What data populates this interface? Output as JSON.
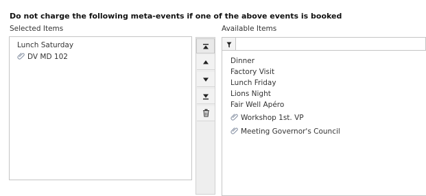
{
  "heading": "Do not charge the following meta-events if one of the above events is booked",
  "selected": {
    "label": "Selected Items",
    "items": [
      {
        "label": "Lunch Saturday",
        "icon": "none"
      },
      {
        "label": "DV MD 102",
        "icon": "paperclip-icon"
      }
    ]
  },
  "controls": {
    "move_top_icon": "move-to-top-icon",
    "move_up_icon": "arrow-up-icon",
    "move_down_icon": "arrow-down-icon",
    "move_bottom_icon": "move-to-bottom-icon",
    "remove_icon": "trash-icon"
  },
  "available": {
    "label": "Available Items",
    "filter_icon": "filter-icon",
    "filter_value": "",
    "items": [
      {
        "label": "Dinner",
        "icon": "none"
      },
      {
        "label": "Factory Visit",
        "icon": "none"
      },
      {
        "label": "Lunch Friday",
        "icon": "none"
      },
      {
        "label": "Lions Night",
        "icon": "none"
      },
      {
        "label": "Fair Well Apéro",
        "icon": "none"
      },
      {
        "label": "Workshop 1st. VP",
        "icon": "paperclip-icon"
      },
      {
        "label": "Meeting Governor's Council",
        "icon": "paperclip-icon"
      }
    ]
  },
  "colors": {
    "border": "#c4c4c4",
    "button_bg": "#eeeeee",
    "icon": "#222222",
    "clip": "#8a94a6"
  }
}
